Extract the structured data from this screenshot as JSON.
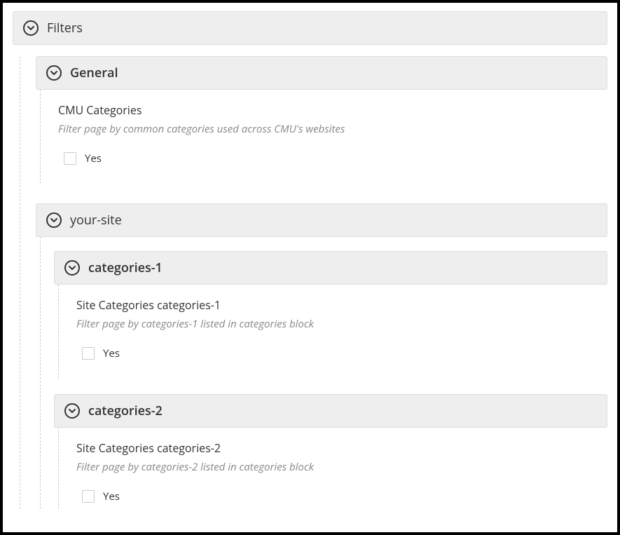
{
  "filters": {
    "title": "Filters",
    "general": {
      "title": "General",
      "field_label": "CMU Categories",
      "field_desc": "Filter page by common categories used across CMU's websites",
      "checkbox_label": "Yes"
    },
    "yoursite": {
      "title": "your-site",
      "cat1": {
        "title": "categories-1",
        "field_label": "Site Categories categories-1",
        "field_desc": "Filter page by categories-1 listed in categories block",
        "checkbox_label": "Yes"
      },
      "cat2": {
        "title": "categories-2",
        "field_label": "Site Categories categories-2",
        "field_desc": "Filter page by categories-2 listed in categories block",
        "checkbox_label": "Yes"
      }
    }
  }
}
